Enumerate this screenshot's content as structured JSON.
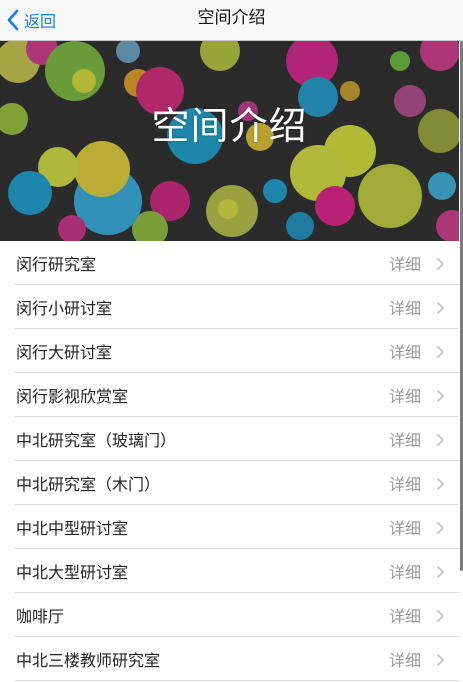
{
  "navbar": {
    "back_label": "返回",
    "title": "空间介绍"
  },
  "banner": {
    "title": "空间介绍",
    "background_color": "#2a2a2a"
  },
  "list": {
    "detail_label": "详细",
    "items": [
      {
        "label": "闵行研究室"
      },
      {
        "label": "闵行小研讨室"
      },
      {
        "label": "闵行大研讨室"
      },
      {
        "label": "闵行影视欣赏室"
      },
      {
        "label": "中北研究室（玻璃门）"
      },
      {
        "label": "中北研究室（木门）"
      },
      {
        "label": "中北中型研讨室"
      },
      {
        "label": "中北大型研讨室"
      },
      {
        "label": "咖啡厅"
      },
      {
        "label": "中北三楼教师研究室"
      }
    ]
  },
  "colors": {
    "accent": "#1a7cf5",
    "detail_text": "#9a9a9a"
  }
}
